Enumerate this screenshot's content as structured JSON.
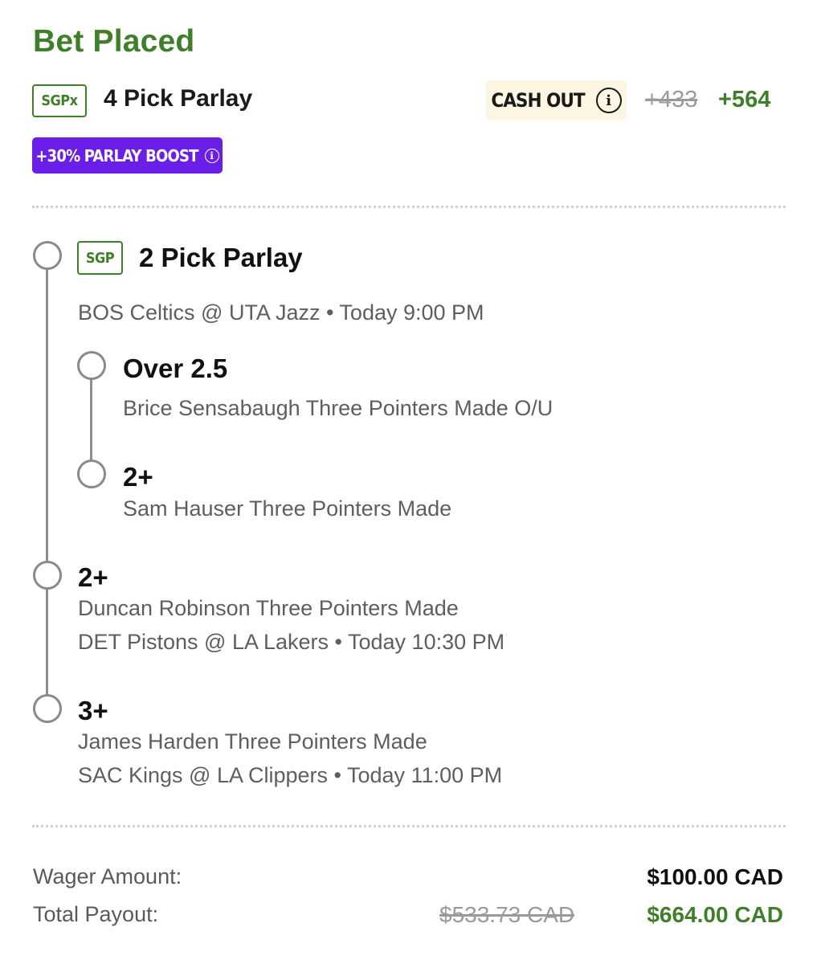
{
  "header": {
    "title": "Bet Placed",
    "bet_type_badge": "SGPx",
    "bet_name": "4 Pick Parlay",
    "cash_out_label": "CASH OUT",
    "odds_original": "+433",
    "odds_boosted": "+564",
    "boost_label": "+30% PARLAY BOOST"
  },
  "sgp_group": {
    "badge": "SGP",
    "title": "2 Pick Parlay",
    "matchup": "BOS Celtics @ UTA Jazz • Today 9:00 PM",
    "legs": [
      {
        "selection": "Over 2.5",
        "market": "Brice Sensabaugh Three Pointers Made O/U"
      },
      {
        "selection": "2+",
        "market": "Sam Hauser Three Pointers Made"
      }
    ]
  },
  "legs": [
    {
      "selection": "2+",
      "market": "Duncan Robinson Three Pointers Made",
      "matchup": "DET Pistons @ LA Lakers • Today 10:30 PM"
    },
    {
      "selection": "3+",
      "market": "James Harden Three Pointers Made",
      "matchup": "SAC Kings @ LA Clippers • Today 11:00 PM"
    }
  ],
  "footer": {
    "wager_label": "Wager Amount:",
    "wager_value": "$100.00 CAD",
    "payout_label": "Total Payout:",
    "payout_original": "$533.73 CAD",
    "payout_boosted": "$664.00 CAD"
  },
  "colors": {
    "accent_green": "#3f7f2a",
    "boost_purple": "#6a1ee8",
    "cashout_bg": "#fdf6e2"
  },
  "icons": {
    "cash_out_info": "info-icon",
    "boost_info": "info-icon"
  }
}
